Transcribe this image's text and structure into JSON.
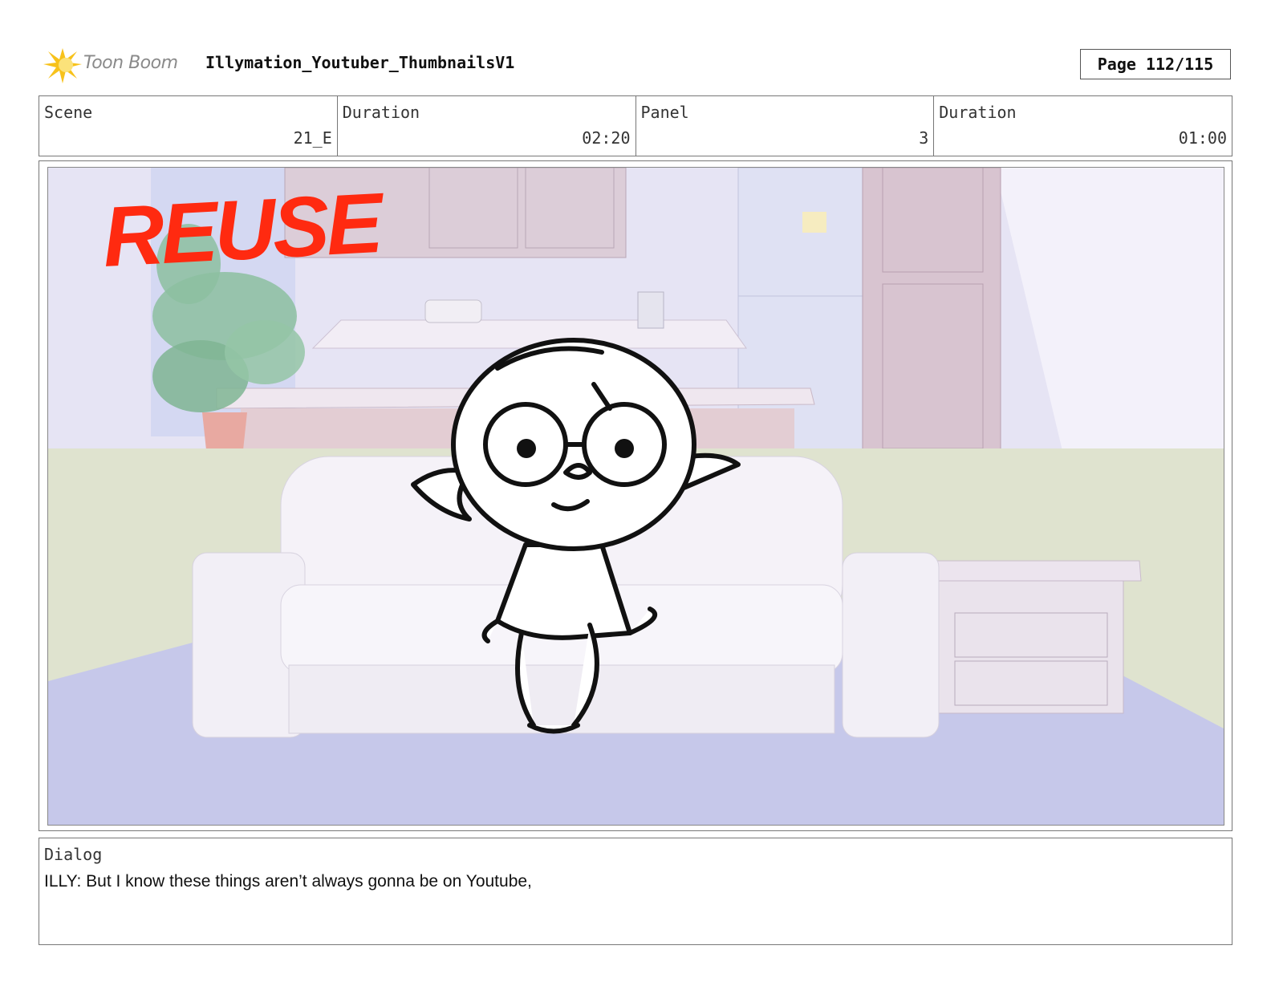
{
  "header": {
    "logo_text": "Toon Boom",
    "title": "Illymation_Youtuber_ThumbnailsV1",
    "page_label": "Page 112/115"
  },
  "info": {
    "scene_label": "Scene",
    "scene_value": "21_E",
    "scene_duration_label": "Duration",
    "scene_duration_value": "02:20",
    "panel_label": "Panel",
    "panel_value": "3",
    "panel_duration_label": "Duration",
    "panel_duration_value": "01:00"
  },
  "panel": {
    "stamp_text": "REUSE",
    "stamp_color": "#ff2a10"
  },
  "dialog": {
    "label": "Dialog",
    "text": "ILLY: But I know these things aren’t always gonna be on Youtube,"
  }
}
